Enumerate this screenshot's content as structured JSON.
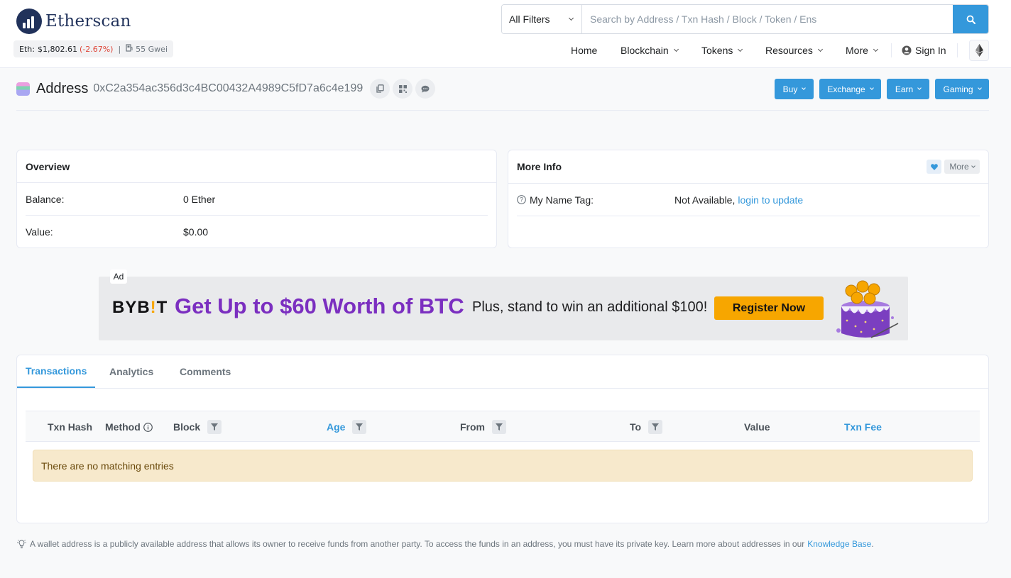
{
  "header": {
    "brand": "Etherscan",
    "price": {
      "label": "Eth:",
      "value": "$1,802.61",
      "change": "(-2.67%)",
      "gas": "55 Gwei"
    },
    "search": {
      "filter": "All Filters",
      "placeholder": "Search by Address / Txn Hash / Block / Token / Ens"
    },
    "nav": [
      "Home",
      "Blockchain",
      "Tokens",
      "Resources",
      "More",
      "Sign In"
    ]
  },
  "title": {
    "label": "Address",
    "address": "0xC2a354ac356d3c4BC00432A4989C5fD7a6c4e199",
    "actions": [
      "Buy",
      "Exchange",
      "Earn",
      "Gaming"
    ]
  },
  "overview": {
    "heading": "Overview",
    "balance_label": "Balance:",
    "balance_value": "0 Ether",
    "value_label": "Value:",
    "value_value": "$0.00"
  },
  "more_info": {
    "heading": "More Info",
    "more_button": "More",
    "name_tag_label": "My Name Tag:",
    "name_tag_value": "Not Available,",
    "name_tag_link": "login to update"
  },
  "ad": {
    "label": "Ad",
    "brand_a": "BYB",
    "brand_b": "!",
    "brand_c": "T",
    "headline": "Get Up to $60 Worth of BTC",
    "subline": "Plus, stand to win an additional $100!",
    "cta": "Register Now"
  },
  "tabs": [
    "Transactions",
    "Analytics",
    "Comments"
  ],
  "table": {
    "columns": [
      "Txn Hash",
      "Method",
      "Block",
      "Age",
      "From",
      "To",
      "Value",
      "Txn Fee"
    ],
    "empty_message": "There are no matching entries"
  },
  "footer": {
    "note": "A wallet address is a publicly available address that allows its owner to receive funds from another party. To access the funds in an address, you must have its private key. Learn more about addresses in our",
    "link": "Knowledge Base",
    "end": "."
  },
  "colors": {
    "accent": "#3498db",
    "brand": "#21325b",
    "negative": "#de4437",
    "ad_purple": "#7b2fc0",
    "ad_orange": "#f7a600"
  }
}
